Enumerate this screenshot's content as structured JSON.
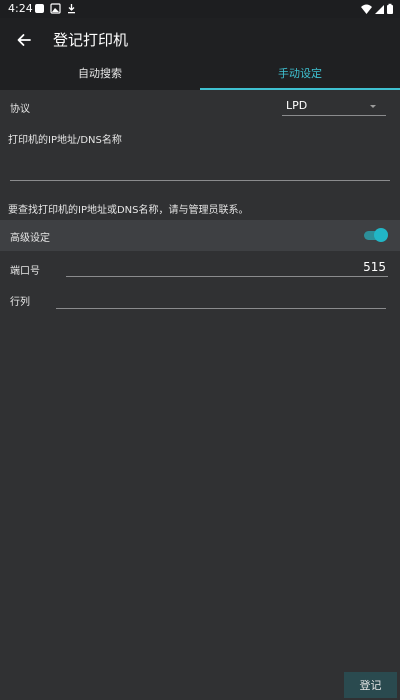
{
  "status_bar": {
    "time": "4:24"
  },
  "app_bar": {
    "title": "登记打印机"
  },
  "tabs": [
    {
      "label": "自动搜索",
      "active": false
    },
    {
      "label": "手动设定",
      "active": true
    }
  ],
  "form": {
    "protocol": {
      "label": "协议",
      "value": "LPD"
    },
    "ip_field": {
      "label": "打印机的IP地址/DNS名称",
      "value": ""
    },
    "help_text": "要查找打印机的IP地址或DNS名称，请与管理员联系。",
    "advanced": {
      "label": "高级设定",
      "enabled": true
    },
    "port": {
      "label": "端口号",
      "value": "515"
    },
    "queue": {
      "label": "行列",
      "value": ""
    }
  },
  "actions": {
    "register_label": "登记"
  },
  "colors": {
    "accent": "#3fc1d1",
    "background": "#303133",
    "app_bar": "#1f2022",
    "toggle_on": "#21b6c6"
  }
}
